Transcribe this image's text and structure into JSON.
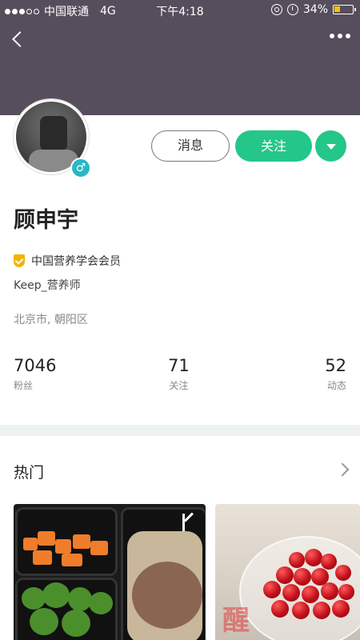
{
  "status_bar": {
    "carrier": "中国联通",
    "network": "4G",
    "time": "下午4:18",
    "battery": "34%",
    "battery_level": 0.34
  },
  "profile": {
    "name": "顾申宇",
    "gender_symbol": "♂",
    "verification": "中国营养学会会员",
    "title": "Keep_营养师",
    "location": "北京市, 朝阳区"
  },
  "actions": {
    "message_label": "消息",
    "follow_label": "关注"
  },
  "stats": [
    {
      "value": "7046",
      "label": "粉丝"
    },
    {
      "value": "71",
      "label": "关注"
    },
    {
      "value": "52",
      "label": "动态"
    }
  ],
  "hot_section": {
    "title": "热门"
  },
  "watermark": "醒"
}
